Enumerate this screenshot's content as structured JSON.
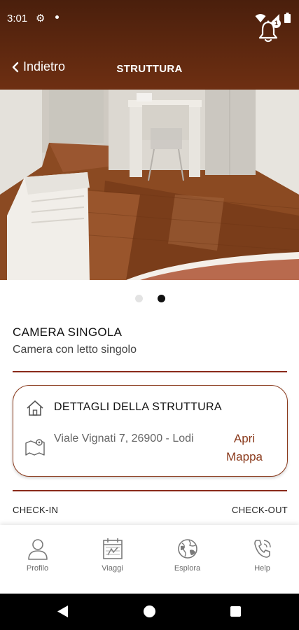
{
  "status": {
    "time": "3:01",
    "icons": [
      "gear-icon",
      "dot-icon",
      "wifi-icon",
      "signal-icon",
      "battery-icon"
    ]
  },
  "header": {
    "back_label": "Indietro",
    "title": "STRUTTURA",
    "notification_count": "1"
  },
  "carousel": {
    "total": 2,
    "active_index": 1
  },
  "room": {
    "title": "CAMERA SINGOLA",
    "subtitle": "Camera con letto singolo"
  },
  "details": {
    "title": "DETTAGLI DELLA STRUTTURA",
    "address": "Viale Vignati 7, 26900 - Lodi",
    "open_map_label": "Apri Mappa"
  },
  "check": {
    "in_label": "CHECK-IN",
    "out_label": "CHECK-OUT"
  },
  "bottom_nav": [
    {
      "label": "Profilo",
      "icon": "user-icon"
    },
    {
      "label": "Viaggi",
      "icon": "calendar-icon"
    },
    {
      "label": "Esplora",
      "icon": "globe-icon"
    },
    {
      "label": "Help",
      "icon": "phone-icon"
    }
  ],
  "colors": {
    "header_dark": "#4a1f0c",
    "header_light": "#6e2f12",
    "accent": "#8a3a1c"
  }
}
